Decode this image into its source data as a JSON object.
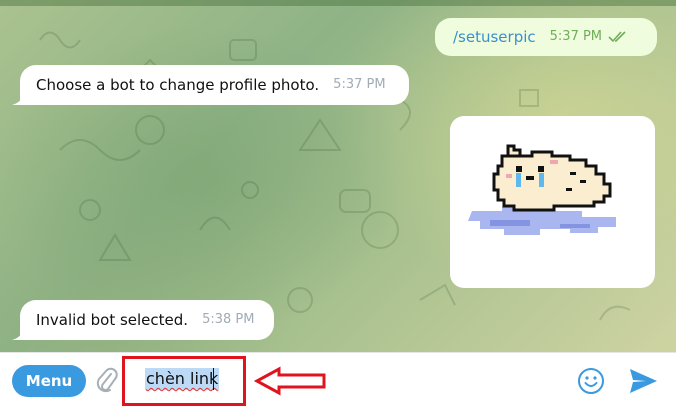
{
  "messages": [
    {
      "side": "out",
      "text": "/setuserpic",
      "time": "5:37 PM",
      "status": "read"
    },
    {
      "side": "in",
      "text": "Choose a bot to change profile photo.",
      "time": "5:37 PM"
    },
    {
      "side": "in",
      "kind": "sticker",
      "description": "pixel cat crying puddle"
    },
    {
      "side": "in",
      "text": "Invalid bot selected.",
      "time": "5:38 PM"
    }
  ],
  "input": {
    "menu_label": "Menu",
    "value": "chèn link",
    "attach_icon": "paperclip-icon",
    "emoji_icon": "smiley-icon",
    "send_icon": "send-arrow-icon"
  },
  "colors": {
    "accent": "#3a9ae0",
    "outgoing_bubble": "#effdde",
    "incoming_bubble": "#ffffff",
    "highlight_box": "#e0141e"
  }
}
